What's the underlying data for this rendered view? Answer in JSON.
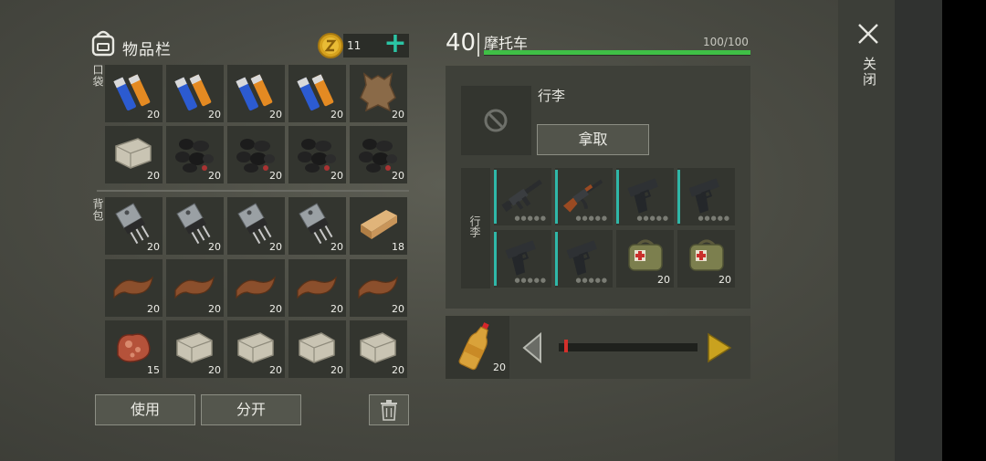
{
  "inventory": {
    "title": "物品栏",
    "currency": {
      "count": "11",
      "add_label": "+"
    },
    "sections": {
      "pocket_label": "口袋",
      "backpack_label": "背包"
    },
    "pocket_items": [
      {
        "icon": "batteries-icon",
        "count": "20"
      },
      {
        "icon": "batteries-icon",
        "count": "20"
      },
      {
        "icon": "batteries-icon",
        "count": "20"
      },
      {
        "icon": "batteries-icon",
        "count": "20"
      },
      {
        "icon": "animal-hide-icon",
        "count": "20"
      },
      {
        "icon": "stone-icon",
        "count": "20"
      },
      {
        "icon": "coal-icon",
        "count": "20"
      },
      {
        "icon": "coal-icon",
        "count": "20"
      },
      {
        "icon": "coal-icon",
        "count": "20"
      },
      {
        "icon": "coal-icon",
        "count": "20"
      }
    ],
    "backpack_items": [
      {
        "icon": "transistor-icon",
        "count": "20"
      },
      {
        "icon": "transistor-icon",
        "count": "20"
      },
      {
        "icon": "transistor-icon",
        "count": "20"
      },
      {
        "icon": "transistor-icon",
        "count": "20"
      },
      {
        "icon": "wood-plank-icon",
        "count": "18"
      },
      {
        "icon": "leather-icon",
        "count": "20"
      },
      {
        "icon": "leather-icon",
        "count": "20"
      },
      {
        "icon": "leather-icon",
        "count": "20"
      },
      {
        "icon": "leather-icon",
        "count": "20"
      },
      {
        "icon": "leather-icon",
        "count": "20"
      },
      {
        "icon": "raw-meat-icon",
        "count": "15"
      },
      {
        "icon": "stone-icon",
        "count": "20"
      },
      {
        "icon": "stone-icon",
        "count": "20"
      },
      {
        "icon": "stone-icon",
        "count": "20"
      },
      {
        "icon": "stone-icon",
        "count": "20"
      }
    ],
    "use_label": "使用",
    "split_label": "分开"
  },
  "vehicle": {
    "level": "40",
    "name": "摩托车",
    "hp_text": "100/100",
    "hp_fraction": 1.0,
    "cargo_label": "行李",
    "take_label": "拿取",
    "cargo_side_label": "行李",
    "cargo_items": [
      {
        "icon": "assault-rifle-icon",
        "count": ""
      },
      {
        "icon": "ak47-icon",
        "count": ""
      },
      {
        "icon": "pistol-icon",
        "count": ""
      },
      {
        "icon": "pistol-icon",
        "count": ""
      },
      {
        "icon": "pistol-icon",
        "count": ""
      },
      {
        "icon": "pistol-icon",
        "count": ""
      },
      {
        "icon": "medkit-bag-icon",
        "count": "20"
      },
      {
        "icon": "medkit-bag-icon",
        "count": "20"
      }
    ],
    "transfer": {
      "icon": "soda-bottle-icon",
      "count": "20",
      "amount_fraction": 0.05
    }
  },
  "close_label": "关闭",
  "colors": {
    "accent_teal": "#2bc4a4",
    "hp_green": "#3fbf46",
    "arrow_gold": "#c9a21f",
    "slider_red": "#d4302b"
  }
}
